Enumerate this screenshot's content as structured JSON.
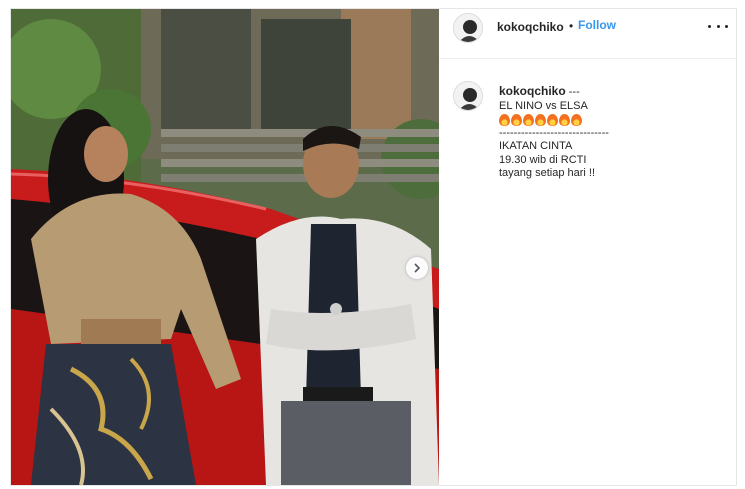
{
  "post": {
    "username": "kokoqchiko",
    "separator": "•",
    "follow_label": "Follow",
    "more_icon": "ellipsis-icon",
    "carousel_icon": "chevron-right-icon"
  },
  "caption": {
    "username": "kokoqchiko",
    "trailing": " ---",
    "line_title": "EL NINO vs ELSA",
    "fire_emoji_count": 7,
    "line_divider": "------------------------------",
    "line_show": "IKATAN CINTA",
    "line_time": "19.30 wib di RCTI",
    "line_schedule": "tayang setiap hari !!"
  },
  "colors": {
    "follow": "#3897f0",
    "text": "#262626",
    "border": "#e6e6e6"
  }
}
